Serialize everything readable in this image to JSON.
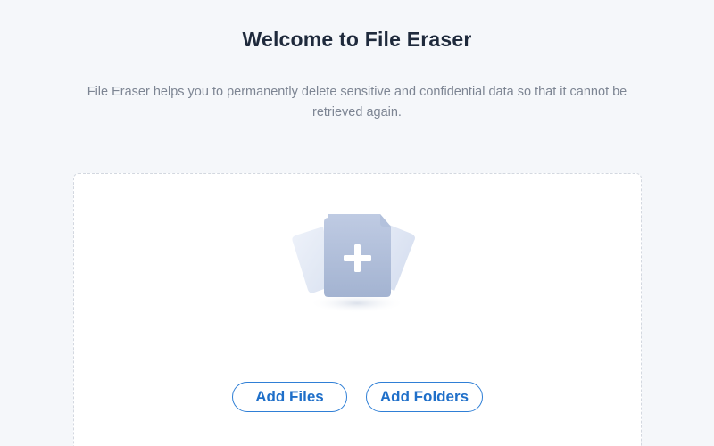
{
  "header": {
    "title": "Welcome to File Eraser",
    "description": "File Eraser helps you to permanently delete sensitive and confidential data so that it cannot be retrieved again."
  },
  "dropzone": {
    "illustration_icon": "add-files-icon",
    "add_files_label": "Add Files",
    "add_folders_label": "Add Folders"
  },
  "colors": {
    "background": "#f5f7fa",
    "title": "#1f2a3c",
    "subtitle": "#7d8593",
    "accent": "#2f7fd6",
    "card": "#ffffff",
    "illustration": "#a9b8d3"
  }
}
